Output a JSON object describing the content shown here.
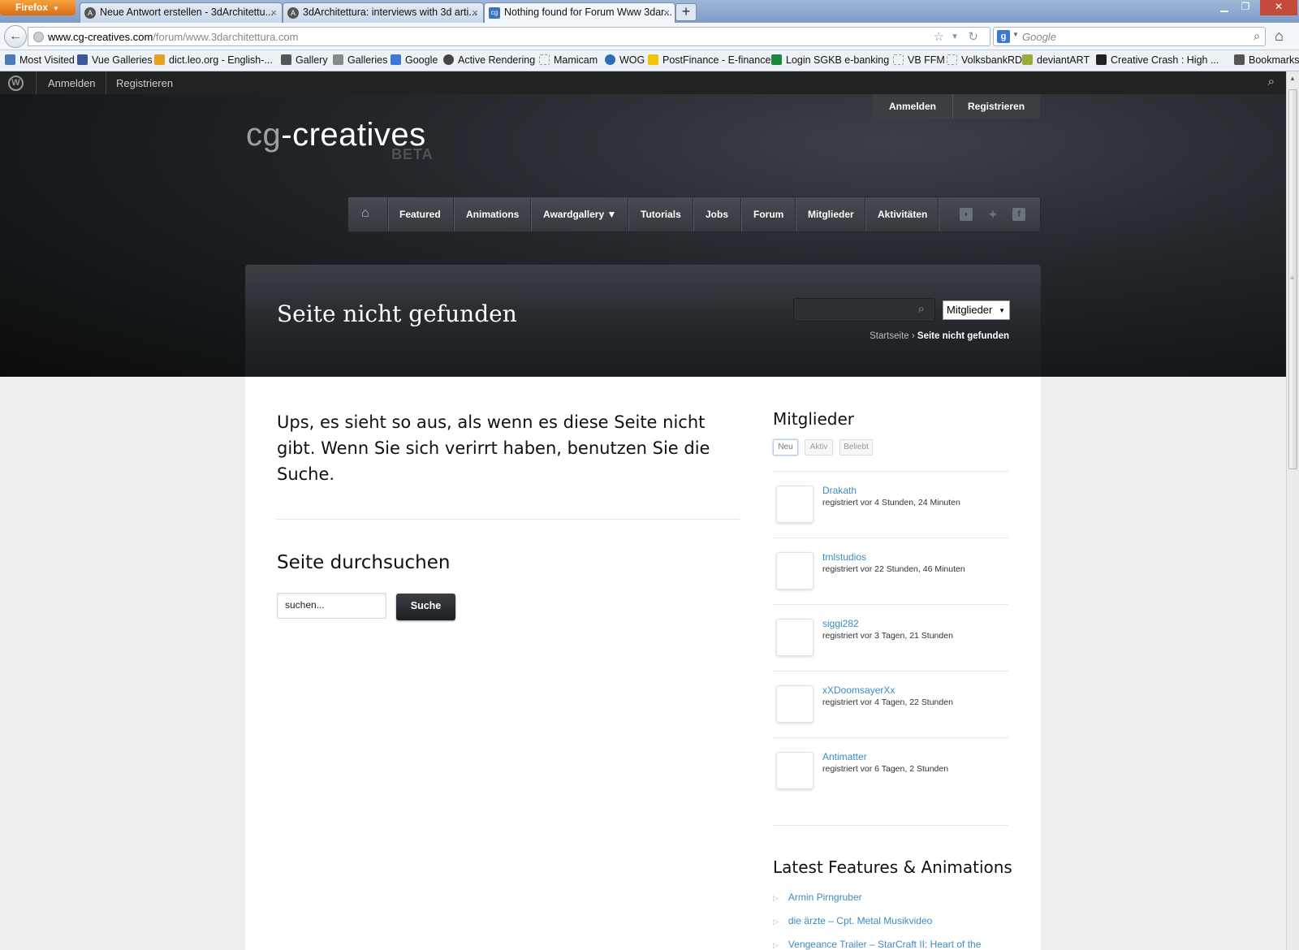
{
  "browser": {
    "menu_button": "Firefox",
    "tabs": [
      {
        "label": "Neue Antwort erstellen - 3dArchitettu..."
      },
      {
        "label": "3dArchitettura: interviews with 3d arti..."
      },
      {
        "label": "Nothing found for Forum Www 3dar..."
      }
    ],
    "url_host": "www.cg-creatives.com",
    "url_path": "/forum/www.3darchitettura.com",
    "search_placeholder": "Google",
    "bookmarks": [
      {
        "label": "Most Visited",
        "color": "#4a7ab8"
      },
      {
        "label": "Vue Galleries",
        "color": "#3b5998"
      },
      {
        "label": "dict.leo.org - English-...",
        "color": "#e8a020"
      },
      {
        "label": "Gallery",
        "color": "#555555"
      },
      {
        "label": "Galleries",
        "color": "#888888"
      },
      {
        "label": "Google",
        "color": "#3c78d8"
      },
      {
        "label": "Active Rendering",
        "color": "#444444"
      },
      {
        "label": "Mamicam",
        "color": "#cccccc"
      },
      {
        "label": "WOG",
        "color": "#2a6fb5"
      },
      {
        "label": "PostFinance - E-finance",
        "color": "#f2c500"
      },
      {
        "label": "Login SGKB e-banking",
        "color": "#1a8a3a"
      },
      {
        "label": "VB FFM",
        "color": "#cccccc"
      },
      {
        "label": "VolksbankRD",
        "color": "#cccccc"
      },
      {
        "label": "deviantART",
        "color": "#9aab3a"
      },
      {
        "label": "Creative Crash : High ...",
        "color": "#222222"
      }
    ],
    "bookmarks_menu": "Bookmarks"
  },
  "adminbar": {
    "login": "Anmelden",
    "register": "Registrieren"
  },
  "site": {
    "logo_cg": "cg",
    "logo_rest": "-creatives",
    "logo_beta": "BETA",
    "top_login": "Anmelden",
    "top_register": "Registrieren",
    "nav": [
      "Featured",
      "Animations",
      "Awardgallery ▼",
      "Tutorials",
      "Jobs",
      "Forum",
      "Mitglieder",
      "Aktivitäten"
    ],
    "page_title": "Seite nicht gefunden",
    "search_scope": "Mitglieder",
    "breadcrumb_home": "Startseite",
    "breadcrumb_sep": "›",
    "breadcrumb_current": "Seite nicht gefunden"
  },
  "main": {
    "lead": "Ups, es sieht so aus, als wenn es diese Seite nicht gibt. Wenn Sie sich verirrt haben, benutzen Sie die Suche.",
    "search_heading": "Seite durchsuchen",
    "search_value": "suchen...",
    "search_button": "Suche"
  },
  "sidebar": {
    "members_heading": "Mitglieder",
    "filters": [
      "Neu",
      "Aktiv",
      "Beliebt"
    ],
    "members": [
      {
        "name": "Drakath",
        "registered": "registriert vor 4 Stunden, 24 Minuten"
      },
      {
        "name": "tmlstudios",
        "registered": "registriert vor 22 Stunden, 46 Minuten"
      },
      {
        "name": "siggi282",
        "registered": "registriert vor 3 Tagen, 21 Stunden"
      },
      {
        "name": "xXDoomsayerXx",
        "registered": "registriert vor 4 Tagen, 22 Stunden"
      },
      {
        "name": "Antimatter",
        "registered": "registriert vor 6 Tagen, 2 Stunden"
      }
    ],
    "latest_heading": "Latest Features & Animations",
    "latest": [
      "Armin Pirngruber",
      "die ärzte – Cpt. Metal Musikvideo",
      "Vengeance Trailer – StarCraft II: Heart of the"
    ]
  }
}
